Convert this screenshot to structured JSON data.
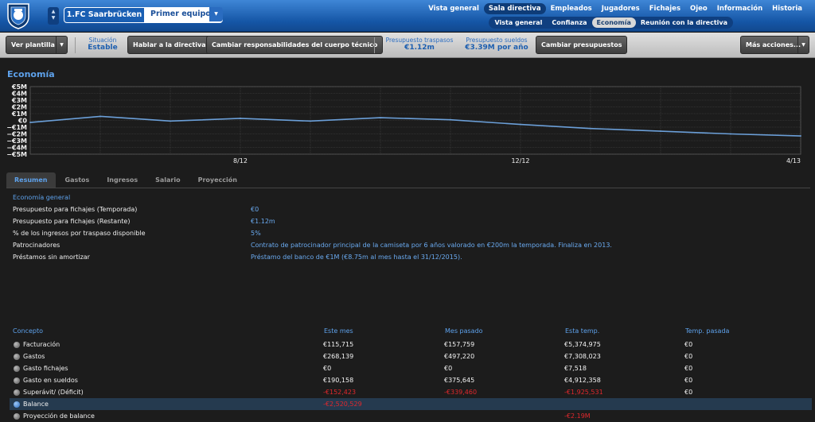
{
  "header": {
    "club": "1.FC Saarbrücken",
    "team": "Primer equipo",
    "nav": [
      "Vista general",
      "Sala directiva",
      "Empleados",
      "Jugadores",
      "Fichajes",
      "Ojeo",
      "Información",
      "Historia"
    ],
    "nav_active": "Sala directiva",
    "subnav": [
      "Vista general",
      "Confianza",
      "Economía",
      "Reunión con la directiva"
    ],
    "subnav_active": "Economía"
  },
  "toolbar": {
    "squad_btn": "Ver plantilla",
    "situation_label": "Situación",
    "situation_value": "Estable",
    "board_btn": "Hablar a la directiva",
    "staff_btn": "Cambiar responsabilidades del cuerpo técnico",
    "transfer_label": "Presupuesto traspasos",
    "transfer_value": "€1.12m",
    "wage_label": "Presupuesto sueldos",
    "wage_value": "€3.39M por año",
    "budget_btn": "Cambiar presupuestos",
    "more_btn": "Más acciones..."
  },
  "section_title": "Economía",
  "chart_data": {
    "type": "line",
    "y_ticks": [
      "€5M",
      "€4M",
      "€3M",
      "€2M",
      "€1M",
      "€0",
      "−€1M",
      "−€2M",
      "−€3M",
      "−€4M",
      "−€5M"
    ],
    "ylim": [
      -5,
      5
    ],
    "x_ticks": [
      {
        "label": "8/12",
        "x": 8
      },
      {
        "label": "12/12",
        "x": 12
      },
      {
        "label": "4/13",
        "x": 16
      }
    ],
    "xlim": [
      5,
      16
    ],
    "series": [
      {
        "color": "#6b9fd8",
        "points": [
          [
            5,
            -0.3
          ],
          [
            6,
            0.6
          ],
          [
            7,
            -0.1
          ],
          [
            8,
            0.3
          ],
          [
            9,
            -0.1
          ],
          [
            10,
            0.4
          ],
          [
            11,
            0.1
          ],
          [
            12,
            -0.6
          ],
          [
            13,
            -1.2
          ],
          [
            14,
            -1.6
          ],
          [
            15,
            -2.0
          ],
          [
            16,
            -2.3
          ]
        ]
      }
    ],
    "grid": true
  },
  "tabs": [
    "Resumen",
    "Gastos",
    "Ingresos",
    "Salario",
    "Proyección"
  ],
  "tab_active": "Resumen",
  "general": {
    "title": "Economía general",
    "rows": [
      {
        "label": "Presupuesto para fichajes (Temporada)",
        "value": "€0"
      },
      {
        "label": "Presupuesto para fichajes (Restante)",
        "value": "€1.12m"
      },
      {
        "label": "% de los ingresos por traspaso disponible",
        "value": "5%"
      },
      {
        "label": "Patrocinadores",
        "value": "Contrato de patrocinador principal de la camiseta por 6 años valorado en €200m la temporada. Finaliza en 2013."
      },
      {
        "label": "Préstamos sin amortizar",
        "value": "Préstamo del banco de €1M (€8.75m al mes hasta el 31/12/2015)."
      }
    ]
  },
  "finance": {
    "headers": [
      "Concepto",
      "Este mes",
      "Mes pasado",
      "Esta temp.",
      "Temp. pasada"
    ],
    "rows": [
      {
        "label": "Facturación",
        "cells": [
          "€115,715",
          "€157,759",
          "€5,374,975",
          "€0"
        ],
        "neg": [
          false,
          false,
          false,
          false
        ]
      },
      {
        "label": "Gastos",
        "cells": [
          "€268,139",
          "€497,220",
          "€7,308,023",
          "€0"
        ],
        "neg": [
          false,
          false,
          false,
          false
        ]
      },
      {
        "label": "Gasto fichajes",
        "cells": [
          "€0",
          "€0",
          "€7,518",
          "€0"
        ],
        "neg": [
          false,
          false,
          false,
          false
        ]
      },
      {
        "label": "Gasto en sueldos",
        "cells": [
          "€190,158",
          "€375,645",
          "€4,912,358",
          "€0"
        ],
        "neg": [
          false,
          false,
          false,
          false
        ]
      },
      {
        "label": "Superávit/ (Déficit)",
        "cells": [
          "-€152,423",
          "-€339,460",
          "-€1,925,531",
          "€0"
        ],
        "neg": [
          true,
          true,
          true,
          false
        ]
      },
      {
        "label": "Balance",
        "cells": [
          "-€2,520,529",
          "",
          "",
          ""
        ],
        "neg": [
          true,
          false,
          false,
          false
        ],
        "selected": true
      },
      {
        "label": "Proyección de balance",
        "cells": [
          "",
          "",
          "-€2.19M",
          ""
        ],
        "neg": [
          false,
          false,
          true,
          false
        ]
      }
    ]
  }
}
